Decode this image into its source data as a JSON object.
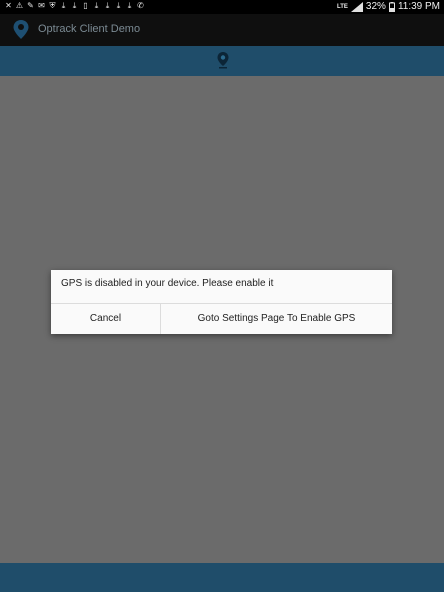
{
  "status_bar": {
    "notification_icons": [
      "close-icon",
      "warning-icon",
      "wrench-icon",
      "mail-icon",
      "shield-icon",
      "download-icon",
      "download-icon",
      "document-icon",
      "download-icon",
      "download-icon",
      "download-icon",
      "download-icon",
      "phone-icon"
    ],
    "network": "LTE",
    "battery": "32%",
    "time": "11:39 PM"
  },
  "app_bar": {
    "title": "Optrack Client Demo",
    "logo_icon": "location-pin-icon"
  },
  "toolbar": {
    "icon": "location-pin-icon",
    "color": "#1f4d6a"
  },
  "dialog": {
    "message": "GPS is disabled in your device. Please enable it",
    "cancel_label": "Cancel",
    "settings_label": "Goto Settings Page To Enable GPS"
  },
  "colors": {
    "background": "#6b6b6b",
    "accent": "#1f4d6a",
    "app_bar": "#0f0f0f"
  }
}
